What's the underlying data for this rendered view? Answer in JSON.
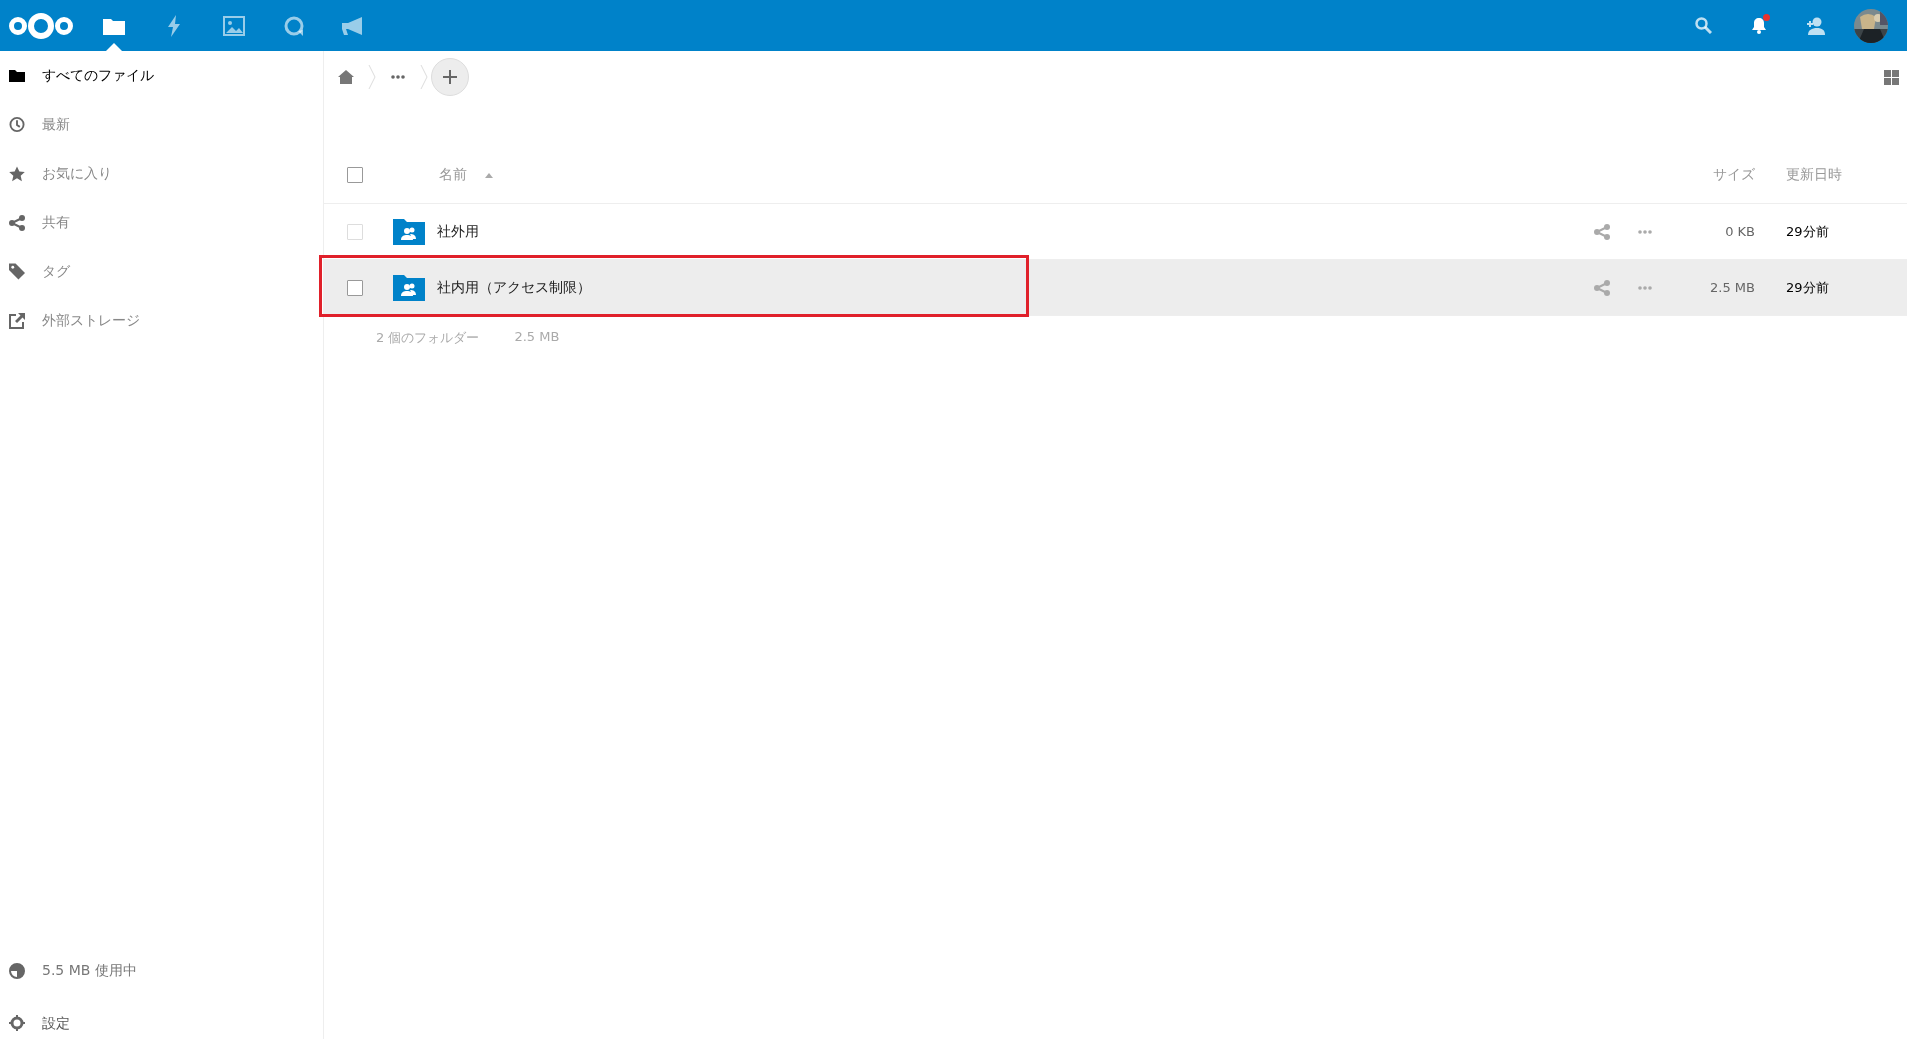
{
  "header": {
    "apps": [
      {
        "kind": "files",
        "selected": true
      },
      {
        "kind": "activity",
        "selected": false
      },
      {
        "kind": "gallery",
        "selected": false
      },
      {
        "kind": "talk",
        "selected": false
      },
      {
        "kind": "announcements",
        "selected": false
      }
    ],
    "notifications": {
      "unread": true
    }
  },
  "sidebar": {
    "items": [
      {
        "kind": "folder",
        "label": "すべてのファイル",
        "selected": true
      },
      {
        "kind": "clock",
        "label": "最新",
        "selected": false
      },
      {
        "kind": "star",
        "label": "お気に入り",
        "selected": false
      },
      {
        "kind": "share",
        "label": "共有",
        "selected": false
      },
      {
        "kind": "tag",
        "label": "タグ",
        "selected": false
      },
      {
        "kind": "external",
        "label": "外部ストレージ",
        "selected": false
      }
    ],
    "usage": "5.5 MB 使用中",
    "settings": "設定"
  },
  "table": {
    "select_all": {
      "checked": false
    },
    "columns": [
      {
        "label": "名前",
        "sorted": true
      },
      {
        "label": "サイズ",
        "sorted": false
      },
      {
        "label": "更新日時",
        "sorted": false
      }
    ],
    "rows": [
      {
        "name": "社外用",
        "size": "0 KB",
        "modified": "29分前",
        "checked": false,
        "selected": false,
        "annotated": false
      },
      {
        "name": "社内用（アクセス制限）",
        "size": "2.5 MB",
        "modified": "29分前",
        "checked": false,
        "selected": true,
        "annotated": true
      }
    ],
    "summary": {
      "count": "2 個のフォルダー",
      "size": "2.5 MB"
    }
  }
}
